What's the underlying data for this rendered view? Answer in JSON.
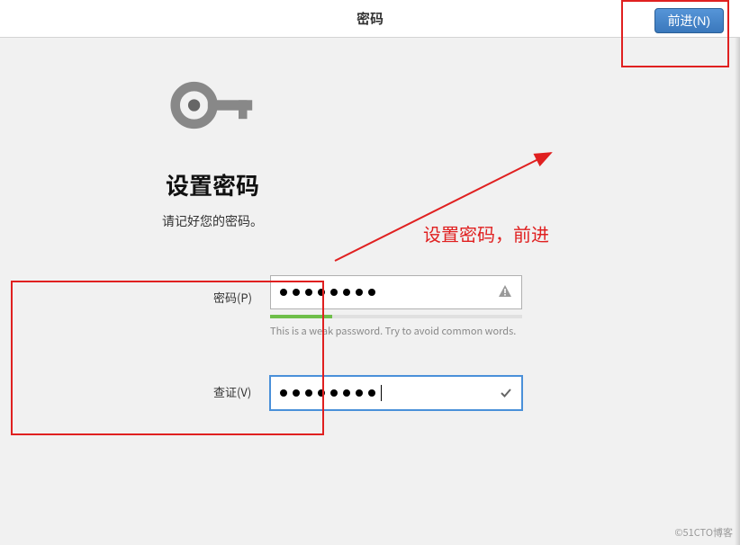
{
  "header": {
    "title": "密码",
    "next_button": "前进(N)"
  },
  "main": {
    "title": "设置密码",
    "subtitle": "请记好您的密码。"
  },
  "form": {
    "password_label": "密码(P)",
    "confirm_label": "查证(V)",
    "password_dots": 8,
    "confirm_dots": 8,
    "strength_hint": "This is a weak password. Try to avoid common words."
  },
  "annotation": {
    "text": "设置密码，前进"
  },
  "watermark": "©51CTO博客"
}
